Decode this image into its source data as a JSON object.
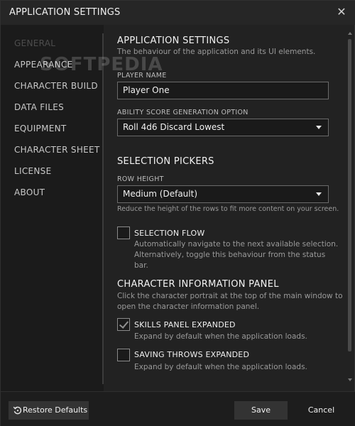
{
  "window": {
    "title": "APPLICATION SETTINGS",
    "close_icon": "close-icon"
  },
  "sidebar": {
    "items": [
      {
        "label": "GENERAL",
        "active": true
      },
      {
        "label": "APPEARANCE"
      },
      {
        "label": "CHARACTER BUILD"
      },
      {
        "label": "DATA FILES"
      },
      {
        "label": "EQUIPMENT"
      },
      {
        "label": "CHARACTER SHEET"
      },
      {
        "label": "LICENSE"
      },
      {
        "label": "ABOUT"
      }
    ]
  },
  "content": {
    "app_settings": {
      "heading": "APPLICATION SETTINGS",
      "subtitle": "The behaviour of the application and its UI elements.",
      "player_name_label": "PLAYER NAME",
      "player_name_value": "Player One",
      "ability_label": "ABILITY SCORE GENERATION OPTION",
      "ability_value": "Roll 4d6 Discard Lowest"
    },
    "selection_pickers": {
      "heading": "SELECTION PICKERS",
      "row_height_label": "ROW HEIGHT",
      "row_height_value": "Medium (Default)",
      "row_height_hint": "Reduce the height of the rows to fit more content on your screen.",
      "selection_flow_label": "SELECTION FLOW",
      "selection_flow_checked": false,
      "selection_flow_desc_1": "Automatically navigate to the next available selection.",
      "selection_flow_desc_2": "Alternatively, toggle this behaviour from the status bar."
    },
    "character_info": {
      "heading": "CHARACTER INFORMATION PANEL",
      "desc_1": "Click the character portrait at the top of the main window to",
      "desc_2": "open the character information panel.",
      "skills_label": "SKILLS PANEL EXPANDED",
      "skills_checked": true,
      "skills_desc": "Expand by default when the application loads.",
      "saving_label": "SAVING THROWS EXPANDED",
      "saving_checked": false,
      "saving_desc": "Expand by default when the application loads."
    }
  },
  "footer": {
    "restore_label": "Restore Defaults",
    "save_label": "Save",
    "cancel_label": "Cancel"
  },
  "watermark": "SOFTPEDIA"
}
